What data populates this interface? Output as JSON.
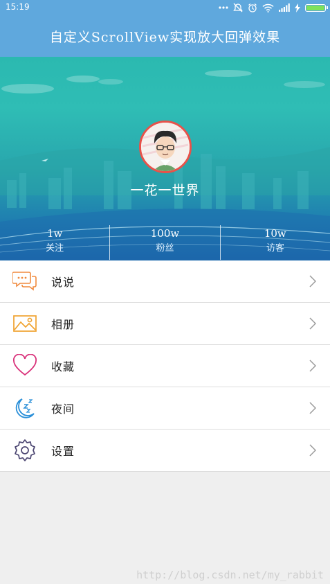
{
  "status_bar": {
    "time": "15:19",
    "icons": [
      "more-dots-icon",
      "alarm-off-icon",
      "alarm-icon",
      "wifi-icon",
      "signal-icon",
      "charging-icon",
      "battery-icon"
    ]
  },
  "title": "自定义ScrollView实现放大回弹效果",
  "profile": {
    "name": "一花一世界",
    "stats": [
      {
        "value": "1w",
        "label": "关注"
      },
      {
        "value": "100w",
        "label": "粉丝"
      },
      {
        "value": "10w",
        "label": "访客"
      }
    ]
  },
  "menu": [
    {
      "label": "说说",
      "icon": "chat-icon",
      "color": "#f08a3e"
    },
    {
      "label": "相册",
      "icon": "photo-icon",
      "color": "#f0a330"
    },
    {
      "label": "收藏",
      "icon": "heart-icon",
      "color": "#d9317a"
    },
    {
      "label": "夜间",
      "icon": "moon-icon",
      "color": "#2a8fd8"
    },
    {
      "label": "设置",
      "icon": "gear-icon",
      "color": "#4a4470"
    }
  ],
  "watermark": "http://blog.csdn.net/my_rabbit",
  "colors": {
    "primary": "#5fa8dd",
    "avatar_border": "#e8524a"
  }
}
